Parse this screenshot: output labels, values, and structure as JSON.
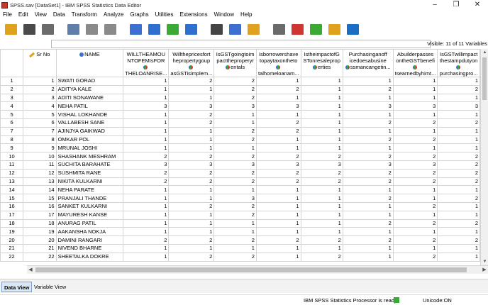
{
  "window": {
    "title": "SPSS.sav [DataSet1] - IBM SPSS Statistics Data Editor",
    "controls": [
      "–",
      "❐",
      "✕"
    ]
  },
  "menu": [
    "File",
    "Edit",
    "View",
    "Data",
    "Transform",
    "Analyze",
    "Graphs",
    "Utilities",
    "Extensions",
    "Window",
    "Help"
  ],
  "toolbar": {
    "buttons": [
      {
        "name": "open-data-icon",
        "color": "#e0a21c"
      },
      {
        "name": "save-icon",
        "color": "#4a4a4a"
      },
      {
        "name": "print-icon",
        "color": "#6b6b6b"
      },
      {
        "name": "recall-dialog-icon",
        "color": "#5f7fa8"
      },
      {
        "name": "undo-icon",
        "color": "#8a8a8a"
      },
      {
        "name": "redo-icon",
        "color": "#8a8a8a"
      },
      {
        "name": "goto-case-icon",
        "color": "#3c6fd1"
      },
      {
        "name": "goto-variable-icon",
        "color": "#2f6fd0"
      },
      {
        "name": "variables-icon",
        "color": "#3aaa35"
      },
      {
        "name": "run-descriptives-icon",
        "color": "#2f6fd0"
      },
      {
        "name": "find-icon",
        "color": "#444444"
      },
      {
        "name": "insert-cases-icon",
        "color": "#3c6fd1"
      },
      {
        "name": "insert-variable-icon",
        "color": "#e0a21c"
      },
      {
        "name": "split-file-icon",
        "color": "#6b6b6b"
      },
      {
        "name": "weight-cases-icon",
        "color": "#d0352f"
      },
      {
        "name": "select-cases-icon",
        "color": "#3aaa35"
      },
      {
        "name": "value-labels-icon",
        "color": "#e0a21c"
      },
      {
        "name": "search-icon",
        "color": "#1a6fc4"
      }
    ]
  },
  "cellbar": {
    "visible_text": "Visible: 11 of 11 Variables"
  },
  "grid": {
    "columns": [
      {
        "label": "Sr No",
        "type": "scale",
        "icon": "pencil-icon"
      },
      {
        "label": "NAME",
        "type": "nominal",
        "icon": "nominal-icon"
      },
      {
        "label": "WILLTHEAMOUNTOFEMIsFORTHELOANRISE...",
        "type": "scale",
        "icon": "scale-icon"
      },
      {
        "label": "WillthepricesfortheproperygoupasGSTisimplem...",
        "type": "scale",
        "icon": "scale-icon"
      },
      {
        "label": "IsGSTgoingtoimpacttheproperyrentals",
        "type": "scale",
        "icon": "scale-icon"
      },
      {
        "label": "IsborrowershavetopaytaxontheototalhomeIoanam...",
        "type": "scale",
        "icon": "scale-icon"
      },
      {
        "label": "IstheimpactofGSTonresalepropertties",
        "type": "scale",
        "icon": "scale-icon"
      },
      {
        "label": "PurchasingaofficedoesabusinessmancangetIn...",
        "type": "scale",
        "icon": "scale-icon"
      },
      {
        "label": "AbuilderpassesontheGSTbenefitsearnedbyhimt...",
        "type": "scale",
        "icon": "scale-icon"
      },
      {
        "label": "IsGSTwillimpactthestampdutyonpurchasingpro...",
        "type": "scale",
        "icon": "scale-icon"
      }
    ],
    "header_lines": [
      [
        "Sr No"
      ],
      [
        "NAME"
      ],
      [
        "WILLTHEAMOU",
        "NTOFEMIsFOR",
        "THELOANRISE..."
      ],
      [
        "Willthepricesfort",
        "hepropertygoup",
        "asGSTisimplem..."
      ],
      [
        "IsGSTgoingtoim",
        "pacttheproperyr",
        "entals"
      ],
      [
        "Isborrowershave",
        "topaytaxontheto",
        "talhomeloanam..."
      ],
      [
        "IstheimpactofG",
        "STonresaleprop",
        "erties"
      ],
      [
        "Purchasinganoff",
        "icedoesabusine",
        "ssmancangetin..."
      ],
      [
        "Abuilderpasses",
        "ontheGSTbenefi",
        "tsearnedbyhimt..."
      ],
      [
        "IsGSTwillimpact",
        "thestampdutyon",
        "purchasingpro..."
      ]
    ],
    "rows": [
      {
        "n": "1",
        "sr": "1",
        "name": "SWATI GORAD",
        "v": [
          "1",
          "2",
          "2",
          "1",
          "1",
          "1",
          "1",
          "1"
        ]
      },
      {
        "n": "2",
        "sr": "2",
        "name": "ADITYA  KALE",
        "v": [
          "1",
          "1",
          "2",
          "2",
          "1",
          "2",
          "1",
          "2"
        ]
      },
      {
        "n": "3",
        "sr": "3",
        "name": "ADITI SONAWANE",
        "v": [
          "1",
          "1",
          "2",
          "1",
          "1",
          "1",
          "1",
          "1"
        ]
      },
      {
        "n": "4",
        "sr": "4",
        "name": "NEHA PATIL",
        "v": [
          "3",
          "3",
          "3",
          "3",
          "1",
          "3",
          "3",
          "3"
        ]
      },
      {
        "n": "5",
        "sr": "5",
        "name": "VISHAL LOKHANDE",
        "v": [
          "1",
          "2",
          "1",
          "1",
          "1",
          "1",
          "1",
          "1"
        ]
      },
      {
        "n": "6",
        "sr": "6",
        "name": "VALLABESH SANE",
        "v": [
          "1",
          "2",
          "1",
          "2",
          "1",
          "2",
          "2",
          "2"
        ]
      },
      {
        "n": "7",
        "sr": "7",
        "name": "AJINJYA GAIKWAD",
        "v": [
          "1",
          "1",
          "2",
          "2",
          "1",
          "1",
          "1",
          "1"
        ]
      },
      {
        "n": "8",
        "sr": "8",
        "name": "OMKAR POL",
        "v": [
          "1",
          "1",
          "2",
          "1",
          "1",
          "2",
          "2",
          "1"
        ]
      },
      {
        "n": "9",
        "sr": "9",
        "name": "MRUNAL JOSHI",
        "v": [
          "1",
          "1",
          "1",
          "1",
          "1",
          "1",
          "1",
          "1"
        ]
      },
      {
        "n": "10",
        "sr": "10",
        "name": "SHASHANK MESHRAM",
        "v": [
          "2",
          "2",
          "2",
          "2",
          "2",
          "2",
          "2",
          "2"
        ]
      },
      {
        "n": "11",
        "sr": "11",
        "name": "SUCHITA BARAHATE",
        "v": [
          "3",
          "3",
          "3",
          "3",
          "3",
          "3",
          "3",
          "2"
        ]
      },
      {
        "n": "12",
        "sr": "12",
        "name": "SUSHMITA RANE",
        "v": [
          "2",
          "2",
          "2",
          "2",
          "2",
          "2",
          "2",
          "2"
        ]
      },
      {
        "n": "13",
        "sr": "13",
        "name": "NIKITA KULKARNI",
        "v": [
          "2",
          "2",
          "2",
          "2",
          "2",
          "2",
          "2",
          "2"
        ]
      },
      {
        "n": "14",
        "sr": "14",
        "name": "NEHA PARATE",
        "v": [
          "1",
          "1",
          "1",
          "1",
          "1",
          "1",
          "1",
          "1"
        ]
      },
      {
        "n": "15",
        "sr": "15",
        "name": "PRANJALI THANDE",
        "v": [
          "1",
          "1",
          "3",
          "1",
          "1",
          "2",
          "1",
          "2"
        ]
      },
      {
        "n": "16",
        "sr": "16",
        "name": "SANKET KULKARNI",
        "v": [
          "1",
          "2",
          "2",
          "1",
          "1",
          "1",
          "2",
          "1"
        ]
      },
      {
        "n": "17",
        "sr": "17",
        "name": "MAYURESH KANSE",
        "v": [
          "1",
          "1",
          "2",
          "1",
          "1",
          "1",
          "1",
          "1"
        ]
      },
      {
        "n": "18",
        "sr": "18",
        "name": "ANURAG PATIL",
        "v": [
          "1",
          "1",
          "1",
          "1",
          "1",
          "2",
          "2",
          "2"
        ]
      },
      {
        "n": "19",
        "sr": "19",
        "name": "AAKANSHA NOKJA",
        "v": [
          "1",
          "1",
          "1",
          "1",
          "1",
          "1",
          "1",
          "1"
        ]
      },
      {
        "n": "20",
        "sr": "20",
        "name": "DAMINI RANGARI",
        "v": [
          "2",
          "2",
          "2",
          "2",
          "2",
          "2",
          "2",
          "2"
        ]
      },
      {
        "n": "21",
        "sr": "21",
        "name": "NIVEND BHARNE",
        "v": [
          "1",
          "1",
          "1",
          "1",
          "1",
          "1",
          "1",
          "1"
        ]
      },
      {
        "n": "22",
        "sr": "22",
        "name": "SHEETALKA DOKRE",
        "v": [
          "1",
          "2",
          "2",
          "1",
          "2",
          "1",
          "2",
          "1"
        ]
      }
    ]
  },
  "tabs": {
    "data_view": "Data View",
    "variable_view": "Variable View"
  },
  "status": {
    "processor": "IBM SPSS Statistics Processor is ready",
    "unicode": "Unicode:ON"
  }
}
